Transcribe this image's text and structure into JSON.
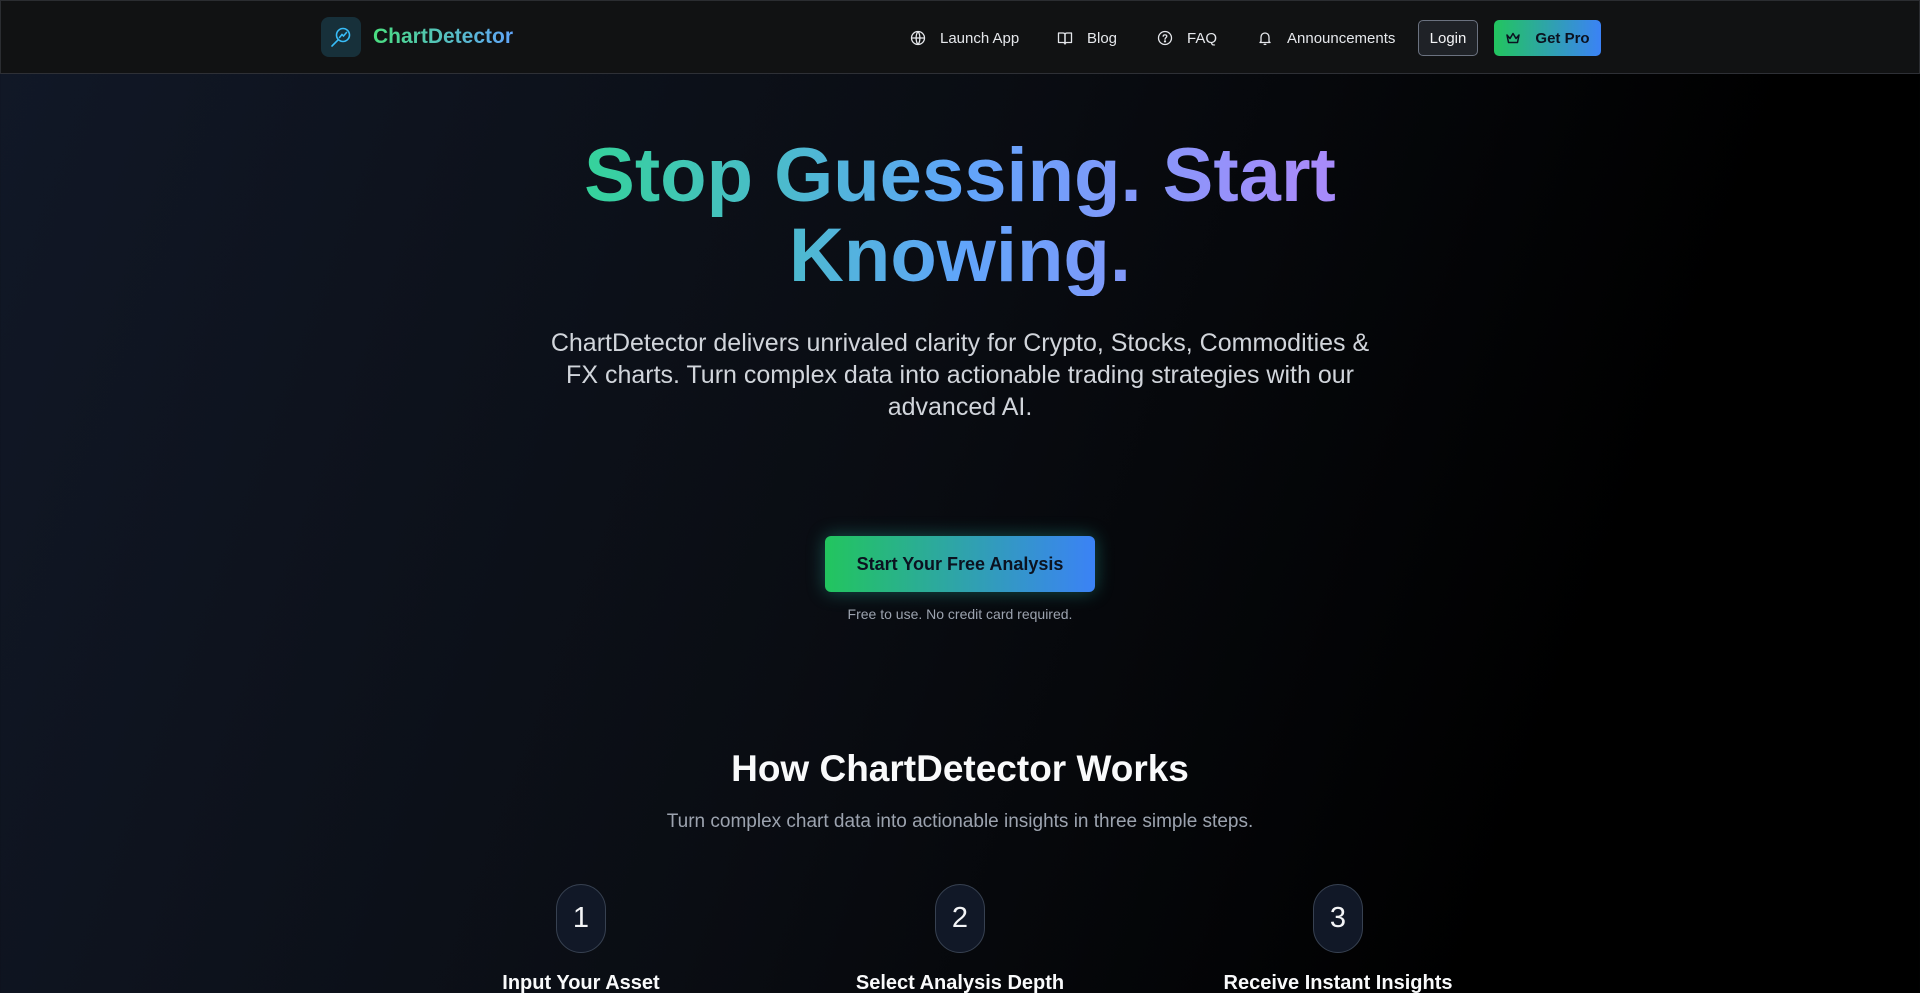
{
  "brand": {
    "name": "ChartDetector",
    "logo_icon": "magnifier-chart-icon"
  },
  "nav": [
    {
      "label": "Launch App",
      "icon": "globe-icon"
    },
    {
      "label": "Blog",
      "icon": "book-icon"
    },
    {
      "label": "FAQ",
      "icon": "help-circle-icon"
    },
    {
      "label": "Announcements",
      "icon": "bell-icon"
    }
  ],
  "auth": {
    "login_label": "Login",
    "pro_label": "Get Pro",
    "pro_icon": "crown-icon"
  },
  "hero": {
    "title_line1": "Stop Guessing. Start",
    "title_line2": "Knowing.",
    "subtitle": "ChartDetector delivers unrivaled clarity for Crypto, Stocks, Commodities & FX charts. Turn complex data into actionable trading strategies with our advanced AI.",
    "cta_label": "Start Your Free Analysis",
    "cta_note": "Free to use. No credit card required."
  },
  "how": {
    "title": "How ChartDetector Works",
    "subtitle": "Turn complex chart data into actionable insights in three simple steps.",
    "steps": [
      {
        "number": "1",
        "title": "Input Your Asset"
      },
      {
        "number": "2",
        "title": "Select Analysis Depth"
      },
      {
        "number": "3",
        "title": "Receive Instant Insights"
      }
    ]
  },
  "colors": {
    "accent_green": "#22c55e",
    "accent_blue": "#3b82f6",
    "accent_purple": "#a78bfa",
    "background": "#0a0d13"
  }
}
